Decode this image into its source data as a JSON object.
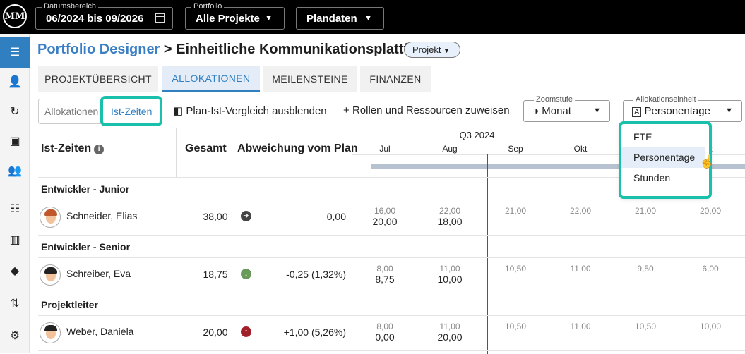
{
  "topbar": {
    "logo": "MM",
    "date": {
      "label": "Datumsbereich",
      "value": "06/2024 bis 09/2026"
    },
    "portfolio": {
      "label": "Portfolio",
      "value": "Alle Projekte"
    },
    "plan": {
      "value": "Plandaten"
    }
  },
  "breadcrumb": {
    "root": "Portfolio Designer",
    "sep": ">",
    "title": "Einheitliche Kommunikationsplattform",
    "chip": "Projekt"
  },
  "tabs": [
    "PROJEKTÜBERSICHT",
    "ALLOKATIONEN",
    "MEILENSTEINE",
    "FINANZEN"
  ],
  "toolbar": {
    "seg_a": "Allokationen",
    "seg_b": "Ist-Zeiten",
    "compare": "Plan-Ist-Vergleich ausblenden",
    "assign": "Rollen und Ressourcen zuweisen",
    "zoom": {
      "label": "Zoomstufe",
      "value": "Monat"
    },
    "unit": {
      "label": "Allokationseinheit",
      "value": "Personentage"
    }
  },
  "table": {
    "h_name": "Ist-Zeiten",
    "h_total": "Gesamt",
    "h_dev": "Abweichung vom Plan",
    "quarter": "Q3 2024",
    "months": [
      "Jul",
      "Aug",
      "Sep",
      "Okt",
      "",
      "z"
    ],
    "groups": [
      {
        "name": "Entwickler - Junior",
        "person": "Schneider, Elias",
        "total": "38,00",
        "dev": "0,00",
        "plan": [
          "16,00",
          "22,00",
          "21,00",
          "22,00",
          "21,00",
          "20,00"
        ],
        "ist": [
          "20,00",
          "18,00",
          "",
          "",
          "",
          ""
        ]
      },
      {
        "name": "Entwickler - Senior",
        "person": "Schreiber, Eva",
        "total": "18,75",
        "dev": "-0,25 (1,32%)",
        "plan": [
          "8,00",
          "11,00",
          "10,50",
          "11,00",
          "9,50",
          "6,00"
        ],
        "ist": [
          "8,75",
          "10,00",
          "",
          "",
          "",
          ""
        ]
      },
      {
        "name": "Projektleiter",
        "person": "Weber, Daniela",
        "total": "20,00",
        "dev": "+1,00 (5,26%)",
        "plan": [
          "8,00",
          "11,00",
          "10,50",
          "11,00",
          "10,50",
          "10,00"
        ],
        "ist": [
          "0,00",
          "20,00",
          "",
          "",
          "",
          ""
        ]
      }
    ]
  },
  "menu": [
    "FTE",
    "Personentage",
    "Stunden"
  ],
  "colors": {
    "accent": "#2f7fc1",
    "highlight": "#19c0ac",
    "today": "#d02020"
  }
}
